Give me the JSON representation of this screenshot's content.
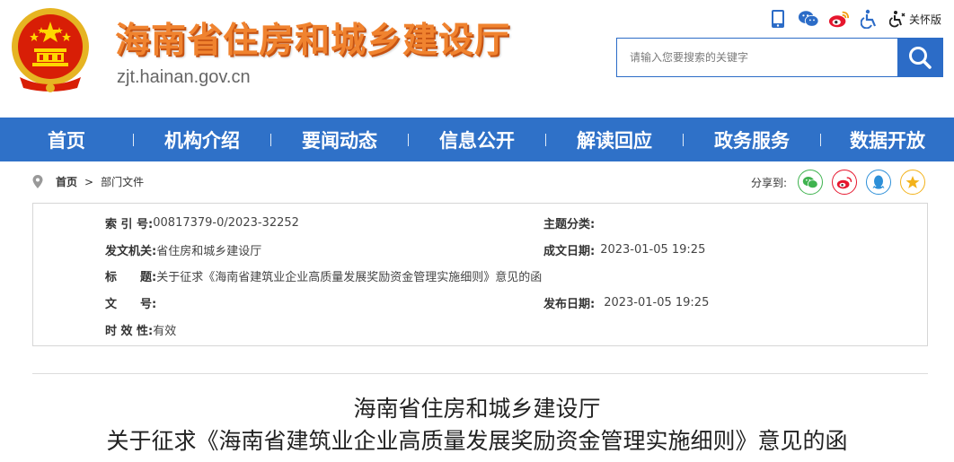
{
  "header": {
    "title": "海南省住房和城乡建设厅",
    "domain": "zjt.hainan.gov.cn",
    "care_mode_label": "关怀版",
    "search_placeholder": "请输入您要搜索的关键字",
    "accent_color": "#2f71c8",
    "title_color": "#f0832f"
  },
  "tools": [
    "mobile-icon",
    "wechat-icon",
    "weibo-icon",
    "accessibility-icon",
    "care-mode-icon"
  ],
  "nav": {
    "items": [
      "首页",
      "机构介绍",
      "要闻动态",
      "信息公开",
      "解读回应",
      "政务服务",
      "数据开放"
    ]
  },
  "breadcrumb": {
    "home": "首页",
    "separator": ">",
    "current": "部门文件"
  },
  "share": {
    "label": "分享到:",
    "targets": [
      "wechat",
      "weibo",
      "qq",
      "qzone"
    ]
  },
  "info": {
    "index_no_label": "索 引 号:",
    "index_no": "00817379-0/2023-32252",
    "topic_label": "主题分类:",
    "topic": "",
    "issuer_label": "发文机关:",
    "issuer": "省住房和城乡建设厅",
    "created_label": "成文日期:",
    "created": "2023-01-05 19:25",
    "title_label": "标　　题:",
    "title": "关于征求《海南省建筑业企业高质量发展奖励资金管理实施细则》意见的函",
    "doc_no_label": "文　　号:",
    "doc_no": "",
    "published_label": "发布日期:",
    "published": "2023-01-05 19:25",
    "validity_label": "时 效 性:",
    "validity": "有效"
  },
  "article": {
    "title_line1": "海南省住房和城乡建设厅",
    "title_line2": "关于征求《海南省建筑业企业高质量发展奖励资金管理实施细则》意见的函"
  }
}
